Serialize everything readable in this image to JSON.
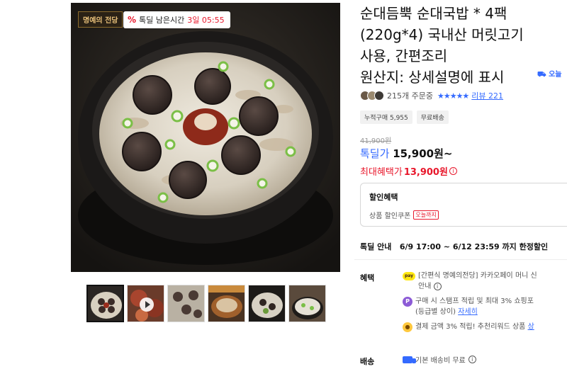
{
  "gallery": {
    "brand_logo": "명예의 전당",
    "deal_badge": {
      "percent_icon": "%",
      "label": "톡딜 남은시간",
      "remaining": "3일 05:55"
    },
    "thumbnail_count": 6,
    "active_thumbnail": 1
  },
  "product": {
    "title_lines": [
      "순대듬뿍 순대국밥 * 4팩",
      "(220g*4) 국내산 머릿고기",
      "사용, 간편조리",
      "원산지: 상세설명에 표시"
    ],
    "today_badge": "오늘",
    "order_count": "215개 주문중",
    "stars": "★★★★★",
    "rating": 5,
    "review_link": "리뷰 221",
    "tags": [
      "누적구매 5,955",
      "무료배송"
    ]
  },
  "price": {
    "original": "41,900원",
    "deal_label": "톡딜가",
    "deal_amount": "15,900원~",
    "max_label": "최대혜택가",
    "max_amount": "13,900원"
  },
  "discount_box": {
    "title": "할인혜택",
    "row_label": "상품 할인쿠폰",
    "row_tag": "오늘까지"
  },
  "deal_info": {
    "label": "톡딜 안내",
    "value": "6/9 17:00 ~ 6/12 23:59 까지 한정할인"
  },
  "benefits": {
    "label": "혜택",
    "items": [
      {
        "icon": "kakaopay-icon",
        "badge": "pay",
        "text": "[간편식 명예의전당] 카카오페이 머니 신",
        "text2": "안내"
      },
      {
        "icon": "point-icon",
        "badge": "P",
        "text": "구매 시 스탬프 적립 및 최대 3% 쇼핑포",
        "text2": "(등급별 상이)",
        "link": "자세히"
      },
      {
        "icon": "coin-icon",
        "badge": "●",
        "text": "결제 금액 3% 적립! 추천리워드 상품",
        "link": "상"
      }
    ]
  },
  "shipping": {
    "label": "배송",
    "text": "기본 배송비 무료"
  },
  "colors": {
    "accent_blue": "#346aff",
    "accent_red": "#e8172b"
  }
}
